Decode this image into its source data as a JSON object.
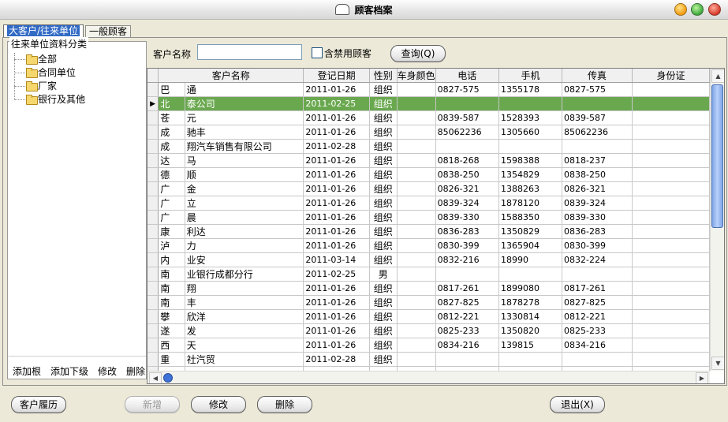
{
  "window": {
    "title": "顾客档案"
  },
  "tabs": [
    {
      "label": "大客户/往来单位",
      "active": true
    },
    {
      "label": "一般顾客",
      "active": false
    }
  ],
  "tree": {
    "legend": "往来单位资料分类",
    "items": [
      "全部",
      "合同单位",
      "厂家",
      "银行及其他"
    ]
  },
  "tree_actions": [
    "添加根",
    "添加下级",
    "修改",
    "删除"
  ],
  "search": {
    "label": "客户名称",
    "value": "",
    "checkbox_label": "含禁用顾客",
    "checkbox_checked": false,
    "query_button": "查询(Q)"
  },
  "grid": {
    "columns": [
      "",
      "客户名称",
      "登记日期",
      "性别",
      "车身颜色",
      "电话",
      "手机",
      "传真",
      "身份证"
    ],
    "selected_row": 1,
    "rows": [
      [
        "巴",
        "通",
        "2011-01-26",
        "组织",
        "",
        "0827-575",
        "1355178",
        "0827-575",
        ""
      ],
      [
        "北",
        "泰公司",
        "2011-02-25",
        "组织",
        "",
        "",
        "",
        "",
        ""
      ],
      [
        "苍",
        "元",
        "2011-01-26",
        "组织",
        "",
        "0839-587",
        "1528393",
        "0839-587",
        ""
      ],
      [
        "成",
        "驰丰",
        "2011-01-26",
        "组织",
        "",
        "85062236",
        "1305660",
        "85062236",
        ""
      ],
      [
        "成",
        "翔汽车销售有限公司",
        "2011-02-28",
        "组织",
        "",
        "",
        "",
        "",
        ""
      ],
      [
        "达",
        "马",
        "2011-01-26",
        "组织",
        "",
        "0818-268",
        "1598388",
        "0818-237",
        ""
      ],
      [
        "德",
        "顺",
        "2011-01-26",
        "组织",
        "",
        "0838-250",
        "1354829",
        "0838-250",
        ""
      ],
      [
        "广",
        "金",
        "2011-01-26",
        "组织",
        "",
        "0826-321",
        "1388263",
        "0826-321",
        ""
      ],
      [
        "广",
        "立",
        "2011-01-26",
        "组织",
        "",
        "0839-324",
        "1878120",
        "0839-324",
        ""
      ],
      [
        "广",
        "晨",
        "2011-01-26",
        "组织",
        "",
        "0839-330",
        "1588350",
        "0839-330",
        ""
      ],
      [
        "康",
        "利达",
        "2011-01-26",
        "组织",
        "",
        "0836-283",
        "1350829",
        "0836-283",
        ""
      ],
      [
        "泸",
        "力",
        "2011-01-26",
        "组织",
        "",
        "0830-399",
        "1365904",
        "0830-399",
        ""
      ],
      [
        "内",
        "业安",
        "2011-03-14",
        "组织",
        "",
        "0832-216",
        "18990",
        "0832-224",
        ""
      ],
      [
        "南",
        "业银行成都分行",
        "2011-02-25",
        "男",
        "",
        "",
        "",
        "",
        ""
      ],
      [
        "南",
        "翔",
        "2011-01-26",
        "组织",
        "",
        "0817-261",
        "1899080",
        "0817-261",
        ""
      ],
      [
        "南",
        "丰",
        "2011-01-26",
        "组织",
        "",
        "0827-825",
        "1878278",
        "0827-825",
        ""
      ],
      [
        "攀",
        "欣洋",
        "2011-01-26",
        "组织",
        "",
        "0812-221",
        "1330814",
        "0812-221",
        ""
      ],
      [
        "遂",
        "发",
        "2011-01-26",
        "组织",
        "",
        "0825-233",
        "1350820",
        "0825-233",
        ""
      ],
      [
        "西",
        "天",
        "2011-01-26",
        "组织",
        "",
        "0834-216",
        "139815",
        "0834-216",
        ""
      ],
      [
        "重",
        "社汽贸",
        "2011-02-28",
        "组织",
        "",
        "",
        "",
        "",
        ""
      ],
      [
        "",
        "",
        "",
        "",
        "",
        "",
        "",
        "",
        ""
      ],
      [
        "",
        "",
        "",
        "",
        "",
        "",
        "",
        "",
        ""
      ]
    ]
  },
  "bottom_buttons": {
    "history": "客户履历",
    "add": "新增",
    "edit": "修改",
    "delete": "删除",
    "exit": "退出(X)"
  },
  "colors": {
    "selection": "#6aa84f",
    "tab_active": "#316ac5"
  }
}
